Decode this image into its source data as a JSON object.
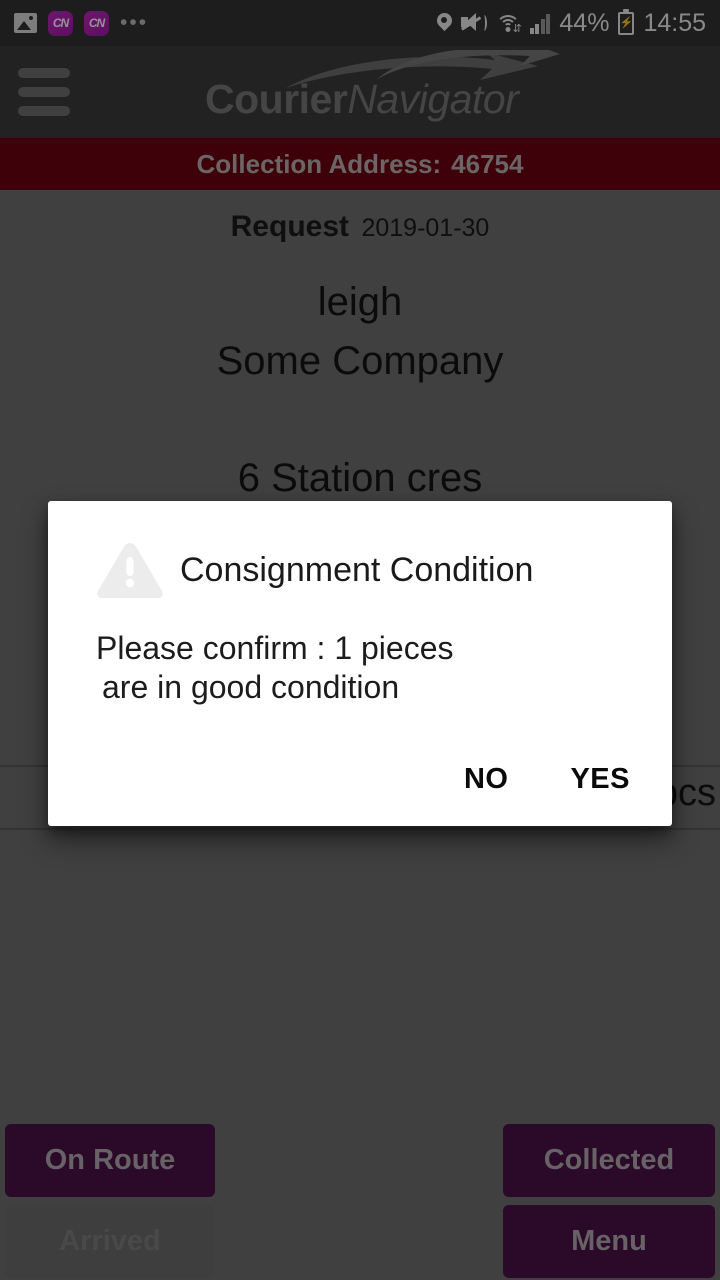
{
  "status_bar": {
    "left_icons": [
      "image-icon",
      "cn-app-icon",
      "cn-app-icon",
      "more-dots-icon"
    ],
    "cn_icon_label": "CN",
    "more_dots": "•••",
    "right_icons": [
      "location-pin-icon",
      "mute-vibrate-icon",
      "wifi-icon",
      "signal-bars-icon",
      "battery-charging-icon"
    ],
    "battery_percent": "44%",
    "time": "14:55"
  },
  "app_bar": {
    "menu_icon": "hamburger-menu-icon",
    "logo_primary": "Courier",
    "logo_secondary": "Navigator"
  },
  "banner": {
    "label": "Collection Address:",
    "value": "46754"
  },
  "details": {
    "request_label": "Request",
    "request_date": "2019-01-30",
    "contact_name": "leigh",
    "company": "Some Company",
    "address_line": "6 Station cres",
    "pieces_label": "pcs"
  },
  "dialog": {
    "icon": "warning-triangle-icon",
    "title": "Consignment Condition",
    "message_line1": "Please confirm :  1  pieces",
    "message_line2": "are in good condition",
    "no_label": "NO",
    "yes_label": "YES"
  },
  "actions": {
    "on_route": "On Route",
    "arrived": "Arrived",
    "collected": "Collected",
    "menu": "Menu"
  },
  "colors": {
    "banner_red": "#6b0311",
    "button_purple": "#4a1145",
    "app_bar_dark": "#3b3b3b",
    "status_bar_dark": "#333333",
    "page_grey": "#6e6e6e",
    "cn_icon_purple": "#b01fb0"
  }
}
